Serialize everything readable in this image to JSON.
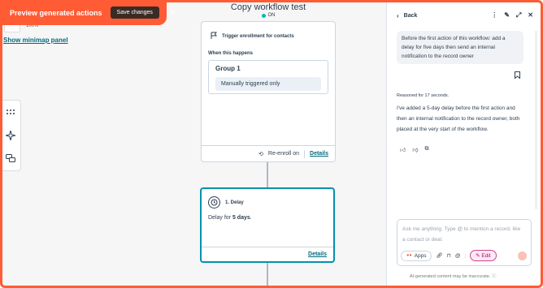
{
  "toast": {
    "title": "Preview generated actions",
    "save_label": "Save changes",
    "close_icon": "close-icon"
  },
  "canvas": {
    "zoom_label": "100%",
    "minimap_link": "Show minimap panel"
  },
  "header": {
    "title": "Copy workflow test",
    "status": "ON",
    "status_color": "#00bda5"
  },
  "trigger_card": {
    "title": "Trigger enrollment for contacts",
    "when_label": "When this happens",
    "group_title": "Group 1",
    "condition": "Manually triggered only",
    "reenroll_label": "Re-enroll on",
    "details_label": "Details"
  },
  "delay_card": {
    "title": "1. Delay",
    "body_prefix": "Delay for ",
    "body_bold": "5 days",
    "body_suffix": ".",
    "details_label": "Details"
  },
  "panel": {
    "back_label": "Back",
    "user_message": "Before the first action of this workflow: add a delay for five days then send an internal notification to the record owner",
    "reasoned": "Reasoned for 17 seconds.",
    "ai_message": "I've added a 5-day delay before the first action and then an internal notification to the record owner, both placed at the very start of the workflow.",
    "input_placeholder": "Ask me anything. Type @ to mention a record, like a contact or deal.",
    "apps_label": "Apps",
    "edit_label": "Edit",
    "disclaimer": "AI-generated content may be inaccurate. ⓘ"
  },
  "colors": {
    "accent": "#ff5c35",
    "link": "#006a80",
    "selected_border": "#0091ae"
  }
}
